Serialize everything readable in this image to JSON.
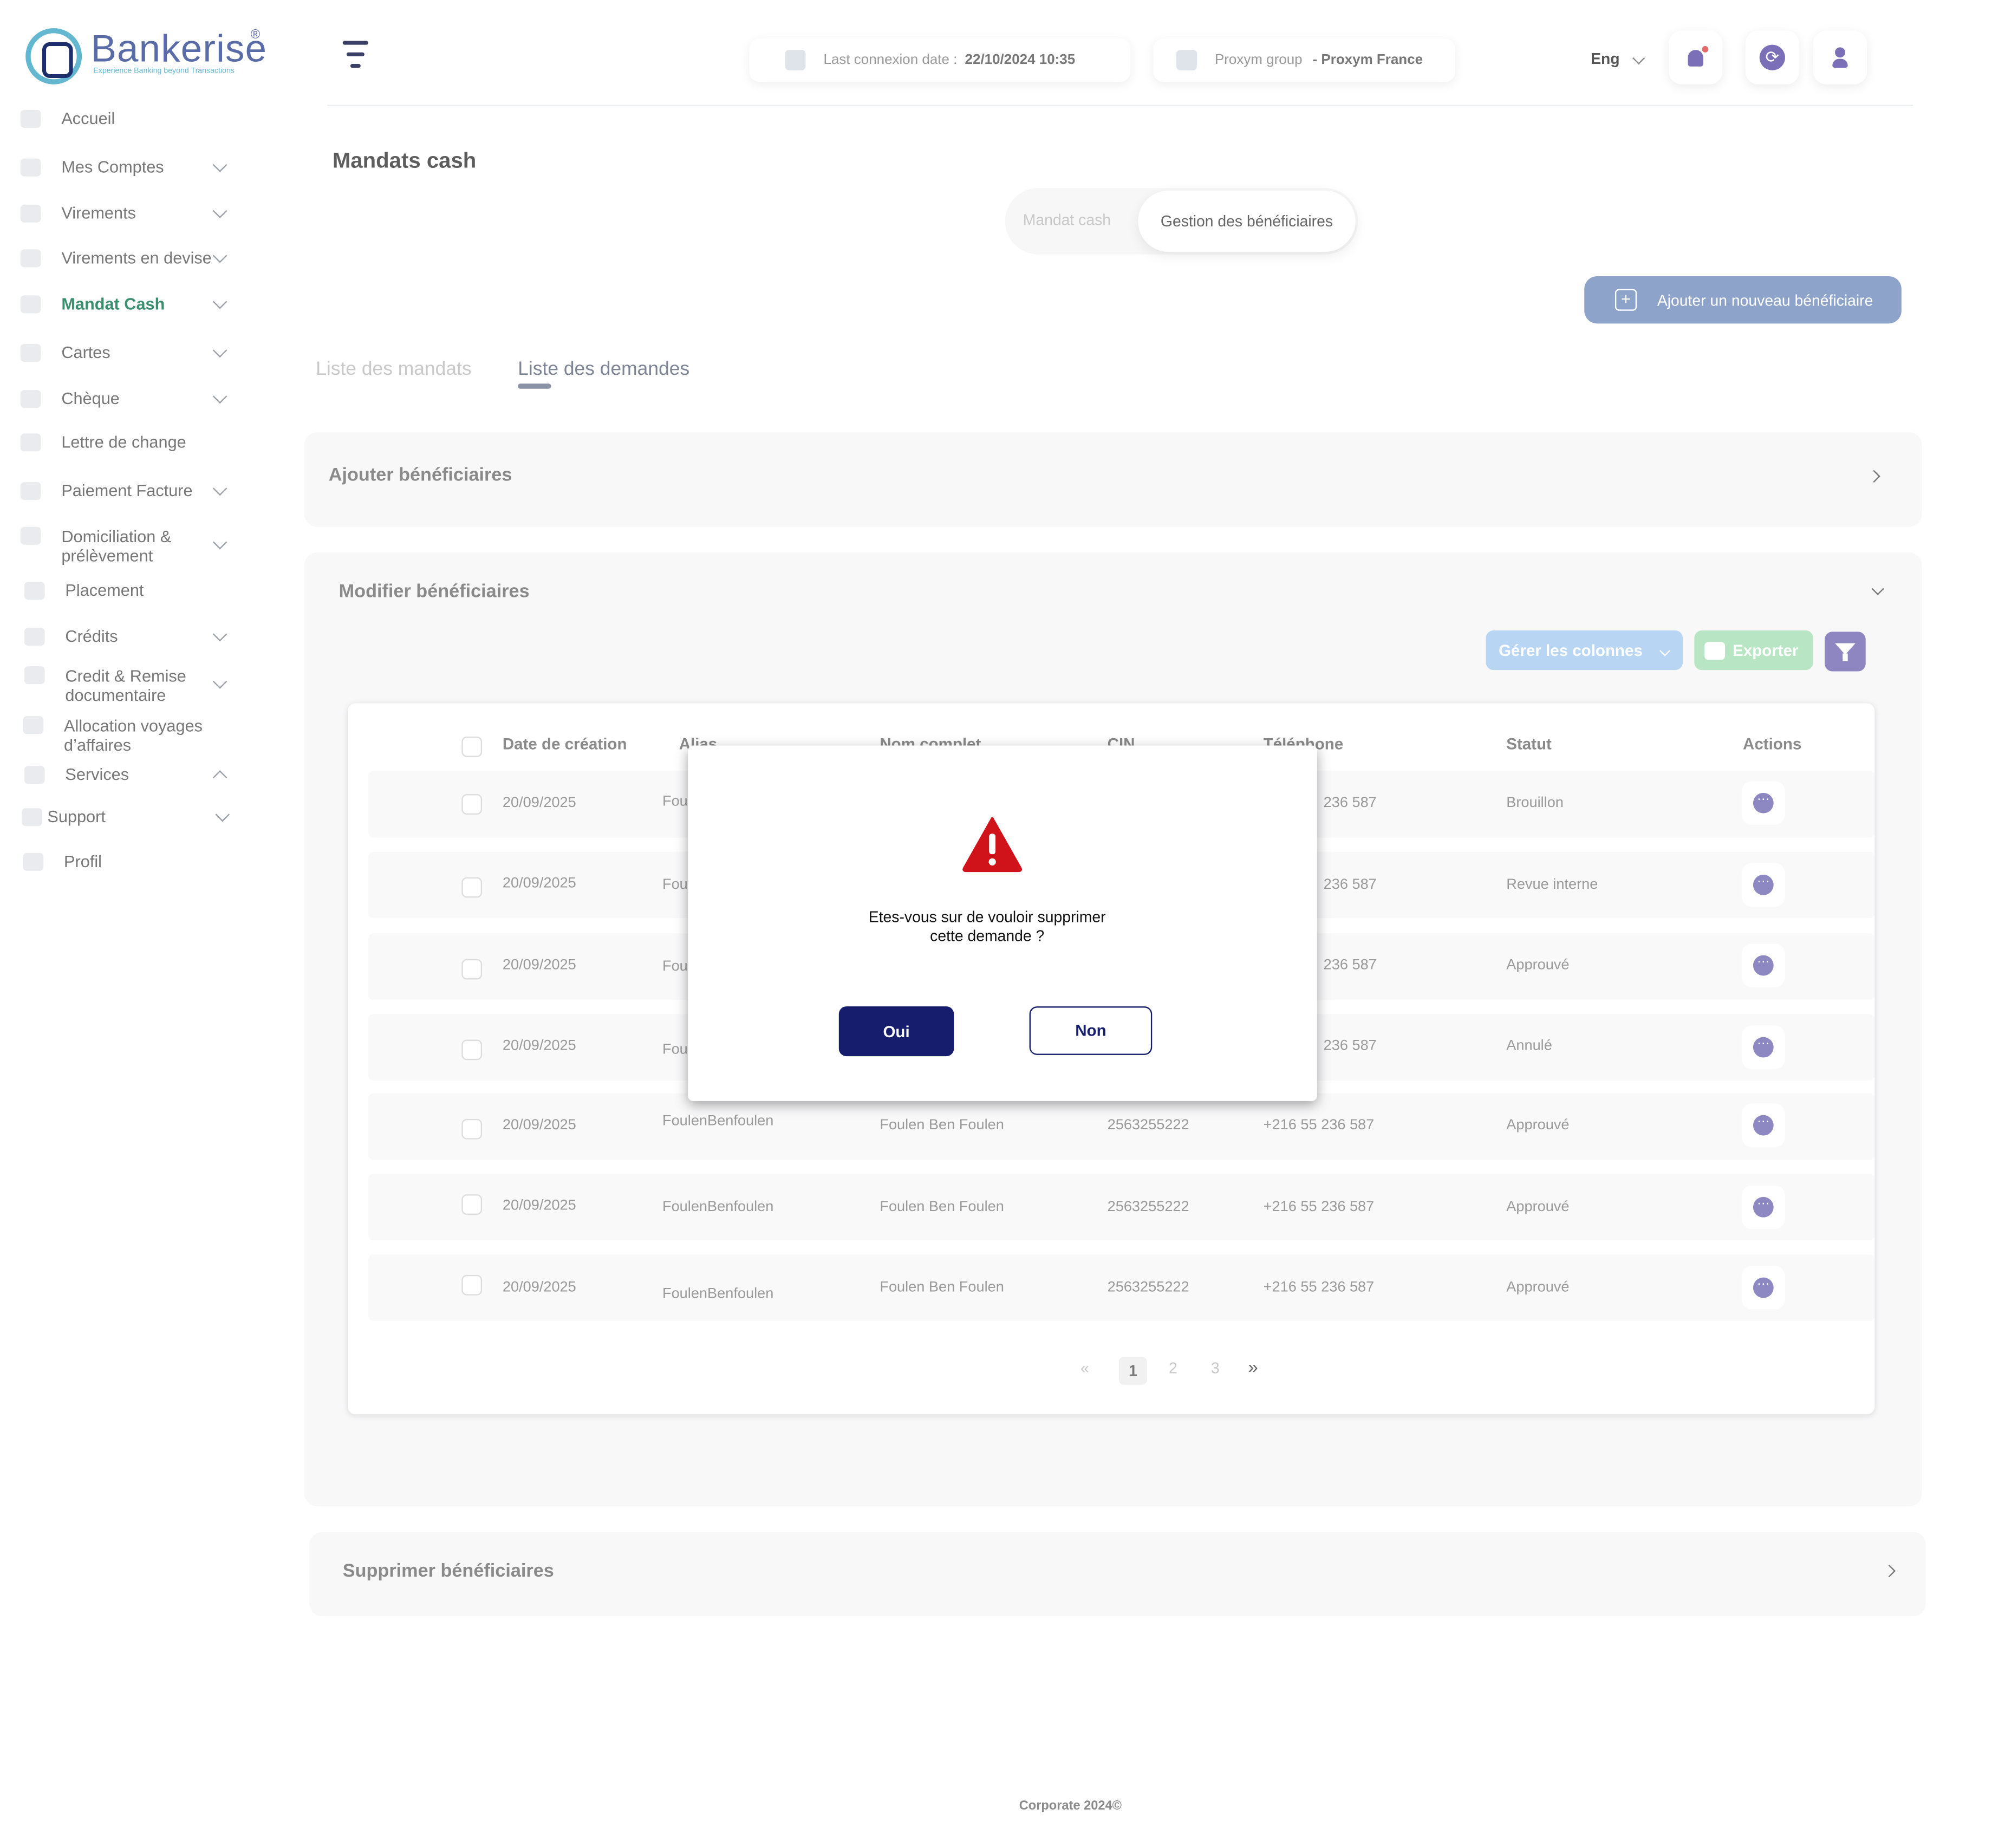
{
  "brand": {
    "name": "Bankerise",
    "registered": "®",
    "tagline": "Experience Banking beyond Transactions"
  },
  "sidebar": {
    "items": [
      {
        "label": "Accueil"
      },
      {
        "label": "Mes Comptes"
      },
      {
        "label": "Virements"
      },
      {
        "label": "Virements en devise"
      },
      {
        "label": "Mandat Cash",
        "active": true
      },
      {
        "label": "Cartes"
      },
      {
        "label": "Chèque"
      },
      {
        "label": "Lettre de change"
      },
      {
        "label": "Paiement Facture"
      },
      {
        "label": "Domiciliation & prélèvement"
      },
      {
        "label": "Placement"
      },
      {
        "label": "Crédits"
      },
      {
        "label": "Credit & Remise documentaire"
      },
      {
        "label": "Allocation  voyages d’affaires"
      },
      {
        "label": "Services"
      },
      {
        "label": "Support"
      },
      {
        "label": "Profil"
      }
    ]
  },
  "header": {
    "last_connexion_label": "Last connexion date :",
    "last_connexion_value": "22/10/2024 10:35",
    "group_label": "Proxym group",
    "group_value": "- Proxym France",
    "language": "Eng",
    "icons": [
      "menu-icon",
      "calendar-icon",
      "building-icon",
      "bell-icon",
      "sync-icon",
      "user-icon"
    ]
  },
  "page": {
    "title": "Mandats cash",
    "toggle": {
      "option_1": "Mandat cash",
      "option_2": "Gestion des bénéficiaires"
    },
    "add_button": "Ajouter un nouveau bénéficiaire",
    "tabs": [
      "Liste des mandats",
      "Liste des demandes"
    ]
  },
  "panels": {
    "add": "Ajouter  bénéficiaires",
    "edit": "Modifier bénéficiaires",
    "delete": "Supprimer bénéficiaires"
  },
  "toolbar": {
    "columns": "Gérer les colonnes",
    "export": "Exporter"
  },
  "table": {
    "headers": [
      "Date de création",
      "Alias",
      "Nom complet",
      "CIN",
      "Téléphone",
      "Statut",
      "Actions"
    ],
    "rows": [
      {
        "date": "20/09/2025",
        "alias": "Fou",
        "name": "",
        "cin": "",
        "phone": "236 587",
        "status": "Brouillon"
      },
      {
        "date": "20/09/2025",
        "alias": "Fou",
        "name": "",
        "cin": "",
        "phone": "236 587",
        "status": "Revue interne"
      },
      {
        "date": "20/09/2025",
        "alias": "Fou",
        "name": "",
        "cin": "",
        "phone": "236 587",
        "status": "Approuvé"
      },
      {
        "date": "20/09/2025",
        "alias": "Fou",
        "name": "",
        "cin": "",
        "phone": "236 587",
        "status": "Annulé"
      },
      {
        "date": "20/09/2025",
        "alias": "FoulenBenfoulen",
        "name": "Foulen Ben Foulen",
        "cin": "2563255222",
        "phone": "+216 55 236 587",
        "status": "Approuvé"
      },
      {
        "date": "20/09/2025",
        "alias": "FoulenBenfoulen",
        "name": "Foulen Ben Foulen",
        "cin": "2563255222",
        "phone": "+216 55 236 587",
        "status": "Approuvé"
      },
      {
        "date": "20/09/2025",
        "alias": "FoulenBenfoulen",
        "name": "Foulen Ben Foulen",
        "cin": "2563255222",
        "phone": "+216 55 236 587",
        "status": "Approuvé"
      }
    ]
  },
  "pagination": {
    "prev": "«",
    "pages": [
      "1",
      "2",
      "3"
    ],
    "next": "»",
    "current": "1"
  },
  "modal": {
    "message_line1": "Etes-vous sur de vouloir  supprimer",
    "message_line2": "cette demande  ?",
    "confirm": "Oui",
    "cancel": "Non",
    "icon": "warning-icon",
    "icon_color": "#d0121b"
  },
  "footer": {
    "text": "Corporate 2024©"
  },
  "colors": {
    "primary": "#151d6c",
    "warning": "#d0121b",
    "accent": "#8e88c2"
  }
}
